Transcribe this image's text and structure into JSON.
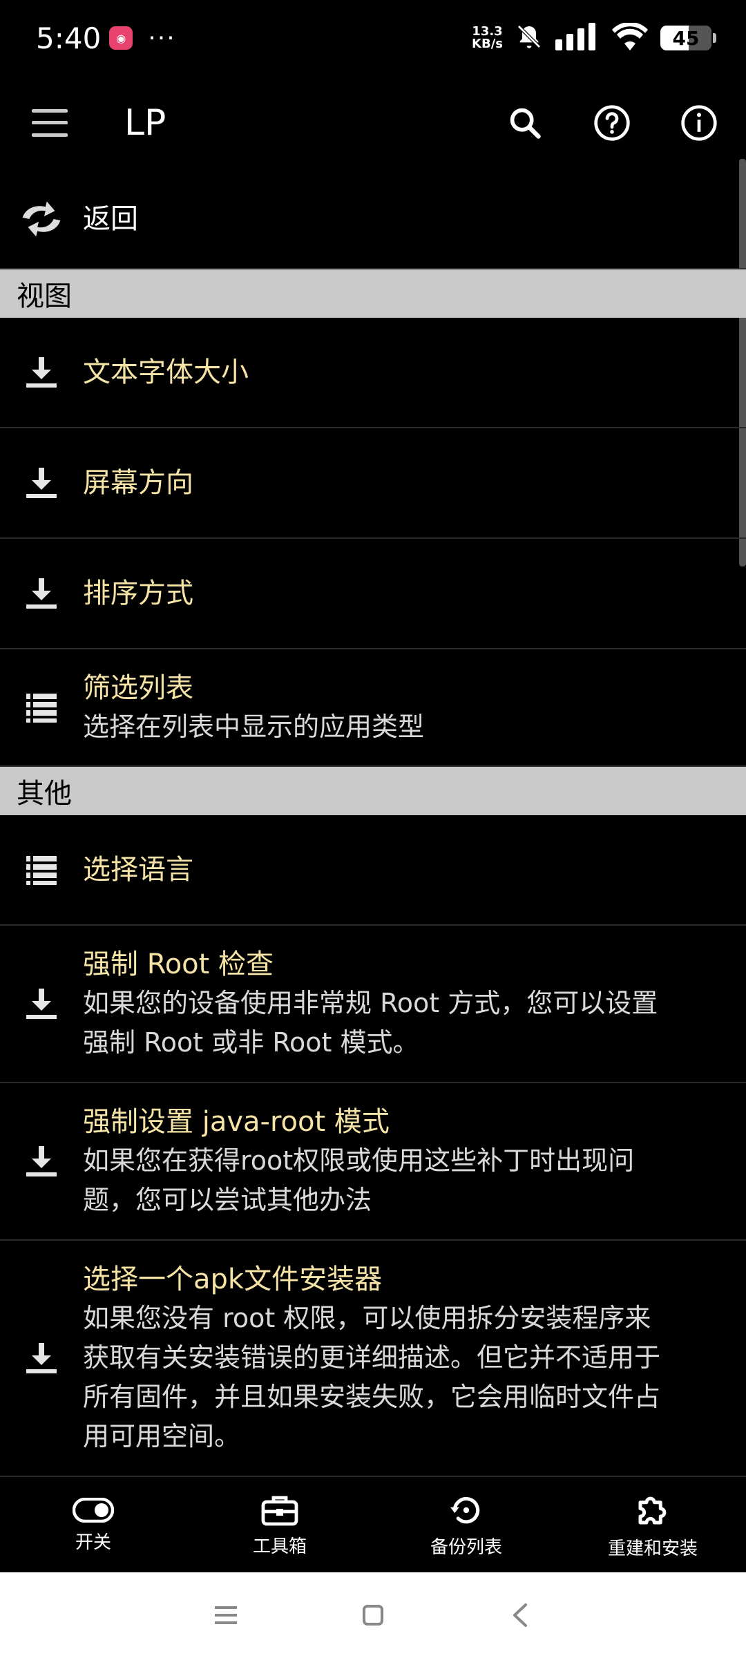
{
  "status_bar": {
    "time": "5:40",
    "more": "···",
    "speed_value": "13.3",
    "speed_unit": "KB/s",
    "battery": "45"
  },
  "app_bar": {
    "title": "LP",
    "icons": [
      "menu-icon",
      "search-icon",
      "help-icon",
      "info-icon"
    ]
  },
  "back_item": {
    "label": "返回",
    "icon": "back-arrows-icon"
  },
  "sections": [
    {
      "header": "视图",
      "items": [
        {
          "title": "文本字体大小",
          "icon": "download-icon"
        },
        {
          "title": "屏幕方向",
          "icon": "download-icon"
        },
        {
          "title": "排序方式",
          "icon": "download-icon"
        },
        {
          "title": "筛选列表",
          "desc": "选择在列表中显示的应用类型",
          "icon": "list-icon"
        }
      ]
    },
    {
      "header": "其他",
      "items": [
        {
          "title": "选择语言",
          "icon": "list-icon"
        },
        {
          "title": "强制 Root 检查",
          "desc": "如果您的设备使用非常规 Root 方式，您可以设置强制 Root 或非 Root 模式。",
          "icon": "download-icon"
        },
        {
          "title": "强制设置 java-root 模式",
          "desc": "如果您在获得root权限或使用这些补丁时出现问题，您可以尝试其他办法",
          "icon": "download-icon"
        },
        {
          "title": "选择一个apk文件安装器",
          "desc": "如果您没有 root 权限，可以使用拆分安装程序来获取有关安装错误的更详细描述。但它并不适用于所有固件，并且如果安装失败，它会用临时文件占用可用空间。",
          "icon": "download-icon"
        }
      ]
    }
  ],
  "bottom_nav": {
    "toggle": "开关",
    "toolbox": "工具箱",
    "backups": "备份列表",
    "rebuild": "重建和安装"
  },
  "colors": {
    "accent_title": "#f6e3a6",
    "section_bg": "#c9c9c9",
    "background": "#000000"
  }
}
